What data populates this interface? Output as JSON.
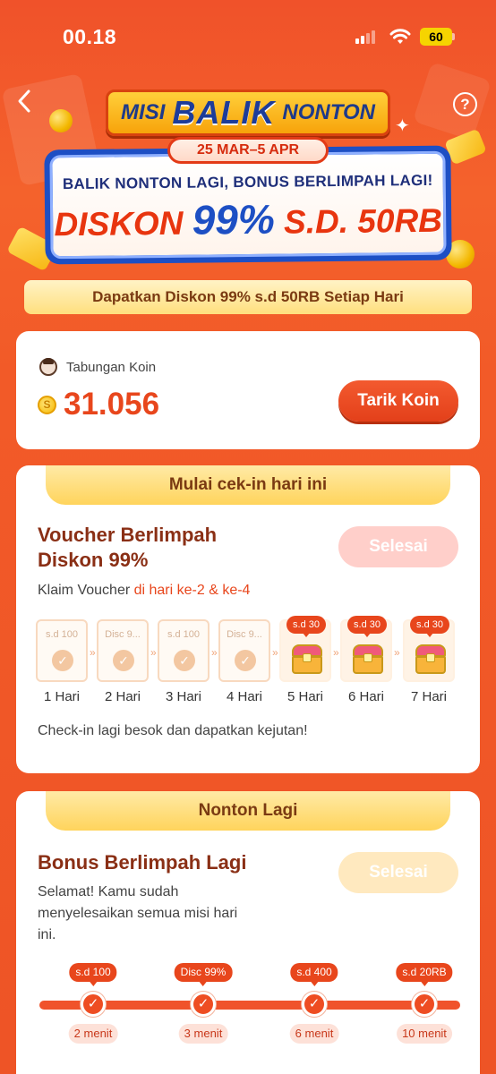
{
  "status_bar": {
    "time": "00.18",
    "battery": "60"
  },
  "nav": {
    "back_icon": "chevron-left-icon",
    "help_icon": "question-circle-icon"
  },
  "hero": {
    "title_left": "MISI",
    "title_center": "BALIK",
    "title_right": "NONTON",
    "date_range": "25 MAR–5 APR",
    "promo_line1": "BALIK NONTON LAGI, BONUS BERLIMPAH LAGI!",
    "promo_prefix": "DISKON",
    "promo_percent": "99%",
    "promo_suffix": "S.D. 50RB"
  },
  "subtitle": "Dapatkan Diskon 99% s.d 50RB Setiap Hari",
  "koin": {
    "label": "Tabungan Koin",
    "coin_symbol": "S",
    "value": "31.056",
    "button": "Tarik Koin"
  },
  "checkin": {
    "ribbon": "Mulai cek-in hari ini",
    "title_line1": "Voucher Berlimpah",
    "title_line2": "Diskon 99%",
    "status_button": "Selesai",
    "desc_prefix": "Klaim Voucher ",
    "desc_highlight": "di hari ke-2 & ke-4",
    "days": [
      {
        "amount": "s.d 100",
        "label": "1 Hari",
        "state": "claimed"
      },
      {
        "amount": "Disc 9...",
        "label": "2 Hari",
        "state": "claimed"
      },
      {
        "amount": "s.d 100",
        "label": "3 Hari",
        "state": "claimed"
      },
      {
        "amount": "Disc 9...",
        "label": "4 Hari",
        "state": "claimed"
      },
      {
        "amount": "s.d 30",
        "label": "5 Hari",
        "state": "gift"
      },
      {
        "amount": "s.d 30",
        "label": "6 Hari",
        "state": "gift"
      },
      {
        "amount": "s.d 30",
        "label": "7 Hari",
        "state": "gift"
      }
    ],
    "note": "Check-in lagi besok dan dapatkan kejutan!"
  },
  "nonton": {
    "ribbon": "Nonton Lagi",
    "title": "Bonus Berlimpah Lagi",
    "status_button": "Selesai",
    "desc_line1": "Selamat! Kamu sudah",
    "desc_line2": "menyelesaikan semua misi hari",
    "desc_line3": "ini.",
    "milestones": [
      {
        "reward": "s.d 100",
        "label": "2 menit"
      },
      {
        "reward": "Disc 99%",
        "label": "3 menit"
      },
      {
        "reward": "s.d 400",
        "label": "6 menit"
      },
      {
        "reward": "s.d 20RB",
        "label": "10 menit"
      }
    ]
  },
  "colors": {
    "background": "#f25a28",
    "accent": "#e8461c",
    "title_brown": "#8a2f15",
    "ribbon_yellow": "#ffd45c",
    "promo_blue": "#1d4fc4"
  }
}
